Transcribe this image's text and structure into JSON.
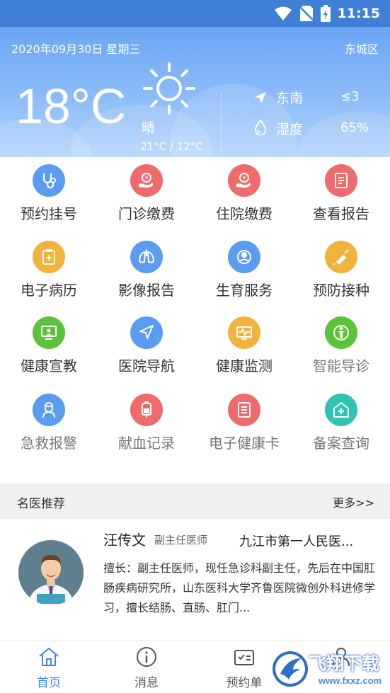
{
  "status_bar": {
    "time": "11:15",
    "icons": [
      "wifi-icon",
      "no-sim-icon",
      "battery-charging-icon"
    ]
  },
  "weather": {
    "date": "2020年09月30日 星期三",
    "district": "东城区",
    "temperature": "18°C",
    "condition": "晴",
    "range": "21°C / 12°C",
    "wind_direction": "东南",
    "wind_level": "≤3",
    "humidity_label": "湿度",
    "humidity_value": "65%",
    "condition_icon": "sun-icon"
  },
  "services": [
    {
      "label": "预约挂号",
      "icon": "stethoscope-icon",
      "color": "#5b9bf0"
    },
    {
      "label": "门诊缴费",
      "icon": "payment-hand-icon",
      "color": "#ef6b6b"
    },
    {
      "label": "住院缴费",
      "icon": "payment-hand-icon",
      "color": "#ef6b6b"
    },
    {
      "label": "查看报告",
      "icon": "report-icon",
      "color": "#ef6b6b"
    },
    {
      "label": "电子病历",
      "icon": "clipboard-icon",
      "color": "#f2b23e"
    },
    {
      "label": "影像报告",
      "icon": "lungs-icon",
      "color": "#5b9bf0"
    },
    {
      "label": "生育服务",
      "icon": "baby-icon",
      "color": "#5b9bf0"
    },
    {
      "label": "预防接种",
      "icon": "syringe-icon",
      "color": "#f2b23e"
    },
    {
      "label": "健康宣教",
      "icon": "presentation-icon",
      "color": "#5bc33a"
    },
    {
      "label": "医院导航",
      "icon": "navigation-icon",
      "color": "#5b9bf0"
    },
    {
      "label": "健康监测",
      "icon": "monitor-pulse-icon",
      "color": "#f2b23e"
    },
    {
      "label": "智能导诊",
      "icon": "body-guide-icon",
      "color": "#5bc33a"
    },
    {
      "label": "急救报警",
      "icon": "doctor-icon",
      "color": "#5b9bf0"
    },
    {
      "label": "献血记录",
      "icon": "blood-bag-icon",
      "color": "#ef6b6b"
    },
    {
      "label": "电子健康卡",
      "icon": "health-card-icon",
      "color": "#ef6b6b"
    },
    {
      "label": "备案查询",
      "icon": "hospital-icon",
      "color": "#2ec4b0"
    }
  ],
  "section": {
    "title": "名医推荐",
    "more": "更多>>"
  },
  "doctor": {
    "name": "汪传文",
    "title": "副主任医师",
    "hospital": "九江市第一人民医...",
    "description": "擅长：副主任医师，现任急诊科副主任，先后在中国肛肠疾病研究所，山东医科大学齐鲁医院微创外科进修学习，擅长结肠、直肠、肛门..."
  },
  "tabs": [
    {
      "label": "首页",
      "icon": "home-icon",
      "active": true
    },
    {
      "label": "消息",
      "icon": "info-icon",
      "active": false
    },
    {
      "label": "预约单",
      "icon": "appointment-icon",
      "active": false
    },
    {
      "label": "",
      "icon": "user-icon",
      "active": false
    }
  ],
  "watermark": {
    "text": "飞翔下载",
    "sub": "www.fxxz.com"
  },
  "colors": {
    "accent": "#3a86e0",
    "status_bar": "#3f7fd6",
    "weather_top": "#6aa5f4"
  }
}
